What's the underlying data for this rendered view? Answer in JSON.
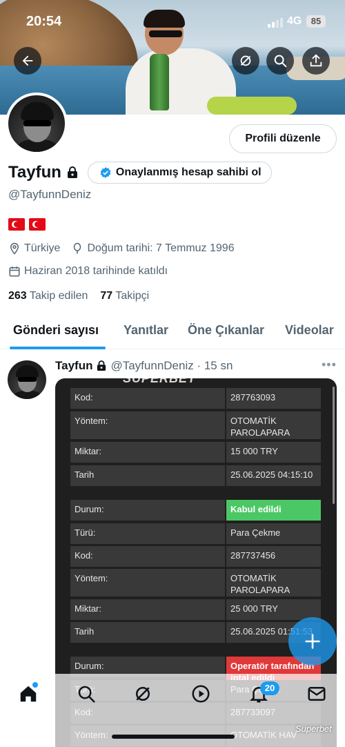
{
  "status_bar": {
    "time": "20:54",
    "network": "4G",
    "battery": "85"
  },
  "header": {
    "back_icon": "arrow-left-icon",
    "grok_icon": "grok-icon",
    "search_icon": "search-icon",
    "share_icon": "share-icon"
  },
  "profile": {
    "name": "Tayfun",
    "handle": "@TayfunnDeniz",
    "edit_button": "Profili düzenle",
    "verify_label": "Onaylanmış hesap sahibi ol",
    "flags": "🇹🇷 🇹🇷",
    "location": "Türkiye",
    "birthday": "Doğum tarihi: 7 Temmuz 1996",
    "joined": "Haziran 2018 tarihinde katıldı",
    "following_count": "263",
    "following_label": "Takip edilen",
    "followers_count": "77",
    "followers_label": "Takipçi"
  },
  "tabs": [
    "Gönderi sayısı",
    "Yanıtlar",
    "Öne Çıkanlar",
    "Videolar"
  ],
  "post": {
    "name": "Tayfun",
    "handle_time": "@TayfunnDeniz · 15 sn",
    "more": "•••",
    "media": {
      "logo": "SUPERBET",
      "rows": [
        {
          "label": "Kod:",
          "value": "287763093"
        },
        {
          "label": "Yöntem:",
          "value": "OTOMATİK PAROLAPARA"
        },
        {
          "label": "Miktar:",
          "value": "15 000 TRY"
        },
        {
          "label": "Tarih",
          "value": "25.06.2025 04:15:10"
        },
        {
          "label": "Durum:",
          "value": "Kabul edildi"
        },
        {
          "label": "Türü:",
          "value": "Para Çekme"
        },
        {
          "label": "Kod:",
          "value": "287737456"
        },
        {
          "label": "Yöntem:",
          "value": "OTOMATİK PAROLAPARA"
        },
        {
          "label": "Miktar:",
          "value": "25 000 TRY"
        },
        {
          "label": "Tarih",
          "value": "25.06.2025 01:51:53"
        },
        {
          "label": "Durum:",
          "value": "Operatör tarafından iptal edildi"
        },
        {
          "label": "Türü:",
          "value": "Para Çekme"
        },
        {
          "label": "Kod:",
          "value": "287733097"
        },
        {
          "label": "Yöntem:",
          "value": "OTOMATİK HAV"
        }
      ]
    }
  },
  "bottom_nav": {
    "items": [
      "home-icon",
      "search-icon",
      "grok-icon",
      "play-icon",
      "notifications-icon",
      "messages-icon"
    ],
    "notification_badge": "20",
    "watermark": "Superbet"
  },
  "colors": {
    "accent": "#1d9bf0",
    "accepted": "#4cc765",
    "rejected": "#e0393a"
  }
}
